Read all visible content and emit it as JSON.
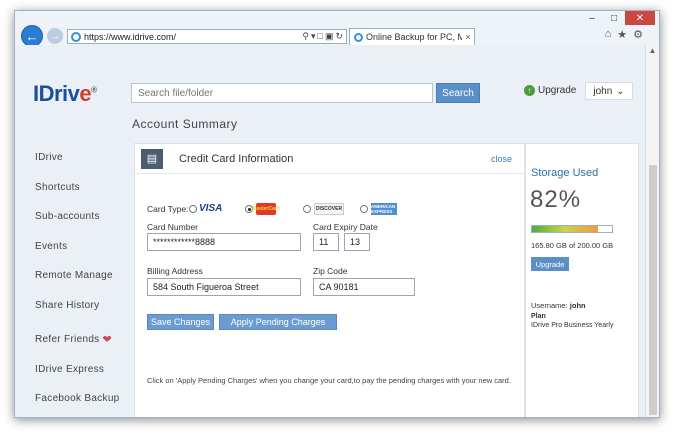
{
  "browser": {
    "url": "https://www.idrive.com/",
    "tab_title": "Online Backup for PC, Mac ...",
    "tab_close": "×"
  },
  "header": {
    "logo_text": "IDriv",
    "logo_e": "e",
    "logo_reg": "®",
    "search_placeholder": "Search file/folder",
    "search_button": "Search",
    "upgrade_label": "Upgrade",
    "username": "john"
  },
  "page_title": "Account Summary",
  "sidebar": {
    "items": [
      {
        "label": "IDrive"
      },
      {
        "label": "Shortcuts"
      },
      {
        "label": "Sub-accounts"
      },
      {
        "label": "Events"
      },
      {
        "label": "Remote Manage"
      },
      {
        "label": "Share History"
      },
      {
        "label": "Refer Friends"
      },
      {
        "label": "IDrive Express"
      },
      {
        "label": "Facebook Backup"
      }
    ]
  },
  "card": {
    "title": "Credit Card Information",
    "close_label": "close",
    "card_type_label": "Card Type:",
    "card_types": [
      {
        "name": "VISA",
        "selected": false
      },
      {
        "name": "MasterCard",
        "selected": true
      },
      {
        "name": "DISCOVER",
        "selected": false
      },
      {
        "name": "AMERICAN EXPRESS",
        "selected": false
      }
    ],
    "card_number_label": "Card Number",
    "card_number_value": "************8888",
    "expiry_label": "Card Expiry Date",
    "expiry_month": "11",
    "expiry_year": "13",
    "billing_label": "Billing Address",
    "billing_value": "584 South Figueroa Street",
    "zip_label": "Zip Code",
    "zip_value": "CA 90181",
    "save_button": "Save Changes",
    "apply_button": "Apply Pending Charges",
    "note": "Click on 'Apply Pending Charges' when you change your card,to pay the pending charges with your new card."
  },
  "storage": {
    "title": "Storage Used",
    "percent_text": "82%",
    "percent_value": 0.82,
    "usage_text": "165.80 GB of 200.00 GB",
    "upgrade_button": "Upgrade",
    "username_label": "Username:",
    "username_value": "john",
    "plan_label": "Plan",
    "plan_value": "IDrive Pro Business Yearly"
  }
}
